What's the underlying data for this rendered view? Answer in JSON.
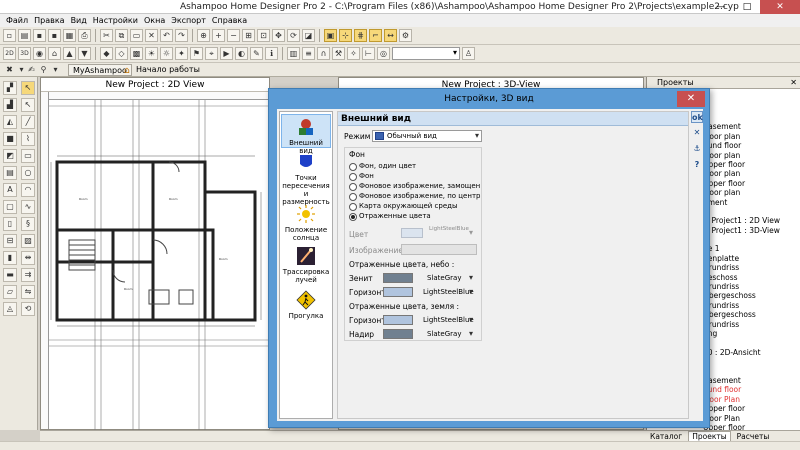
{
  "window": {
    "title": "Ashampoo Home Designer Pro 2 - C:\\Program Files (x86)\\Ashampoo\\Ashampoo Home Designer Pro 2\\Projects\\example2.cyp",
    "minimize": "—",
    "maximize": "□",
    "close": "✕"
  },
  "menu": [
    "Файл",
    "Правка",
    "Вид",
    "Настройки",
    "Окна",
    "Экспорт",
    "Справка"
  ],
  "toolbar3": {
    "tab_myashampoo": "MyAshampoo",
    "tab_start": "Начало работы"
  },
  "view2d": {
    "title": "New Project : 2D View"
  },
  "view3d": {
    "title": "New Project : 3D-View"
  },
  "right_panel": {
    "title": "Проекты",
    "close": "✕",
    "tree": [
      {
        "text": "1"
      },
      {
        "text": "Basement"
      },
      {
        "text": "Floor plan"
      },
      {
        "text": "ound floor"
      },
      {
        "text": "Floor plan"
      },
      {
        "text": "Upper floor"
      },
      {
        "text": "Floor plan"
      },
      {
        "text": "Upper floor"
      },
      {
        "text": "Floor plan"
      },
      {
        "text": "nment"
      },
      {
        "text": ""
      },
      {
        "text": "w Project1 : 2D View"
      },
      {
        "text": "w Project1 : 3D-View"
      },
      {
        "text": ""
      },
      {
        "text": "de 1"
      },
      {
        "text": "denplatte"
      },
      {
        "text": "Grundriss"
      },
      {
        "text": "geschoss"
      },
      {
        "text": "Grundriss"
      },
      {
        "text": "Obergeschoss"
      },
      {
        "text": "Grundriss"
      },
      {
        "text": "Obergeschoss"
      },
      {
        "text": "Grundriss"
      },
      {
        "text": "ung"
      },
      {
        "text": ""
      },
      {
        "text": "10 : 2D-Ansicht"
      },
      {
        "text": ""
      },
      {
        "text": "1",
        "red": true
      },
      {
        "text": "Basement"
      },
      {
        "text": "ound floor",
        "red": true
      },
      {
        "text": "Floor Plan",
        "red": true
      },
      {
        "text": "Upper floor"
      },
      {
        "text": "Floor Plan"
      },
      {
        "text": "Upper floor"
      },
      {
        "text": "Floor Plan"
      }
    ]
  },
  "bottom_tabs": [
    "Каталог",
    "Проекты",
    "Расчеты"
  ],
  "dialog": {
    "title": "Настройки, 3D вид",
    "close": "✕",
    "nav": [
      {
        "label": "Внешний вид"
      },
      {
        "label": "Точки пересечения и размерность"
      },
      {
        "label": "Положение солнца"
      },
      {
        "label": "Трассировка лучей"
      },
      {
        "label": "Прогулка"
      }
    ],
    "header": "Внешний вид",
    "mode_label": "Режим",
    "mode_value": "Обычный вид",
    "bg_label": "Фон",
    "bg_options": [
      {
        "label": "Фон, один цвет"
      },
      {
        "label": "Фон"
      },
      {
        "label": "Фоновое изображение, замощен"
      },
      {
        "label": "Фоновое изображение, по центр"
      },
      {
        "label": "Карта окружающей среды"
      },
      {
        "label": "Отраженные цвета"
      }
    ],
    "color_label": "Цвет",
    "color_value": "LightSteelBlue",
    "image_label": "Изображение",
    "sky_label": "Отраженные цвета, небо :",
    "zenith_label": "Зенит",
    "zenith_color_name": "SlateGray",
    "horizon_label": "Горизонт",
    "horizon_color_name": "LightSteelBlue",
    "ground_label": "Отраженные цвета, земля :",
    "ground_horizon_label": "Горизонт",
    "ground_horizon_color_name": "LightSteelBlue",
    "nadir_label": "Надир",
    "nadir_color_name": "SlateGray",
    "side_ok": "ok",
    "side_cancel": "✕",
    "side_help": "?",
    "colors": {
      "slategray": "#708090",
      "lightsteelblue": "#b0c4de",
      "dialog_frame": "#5b9bd5",
      "close_red": "#c75050"
    },
    "icons": [
      "house-appearance-icon",
      "intersection-icon",
      "sun-icon",
      "raytrace-icon",
      "walk-sign-icon",
      "anchor-icon"
    ]
  }
}
